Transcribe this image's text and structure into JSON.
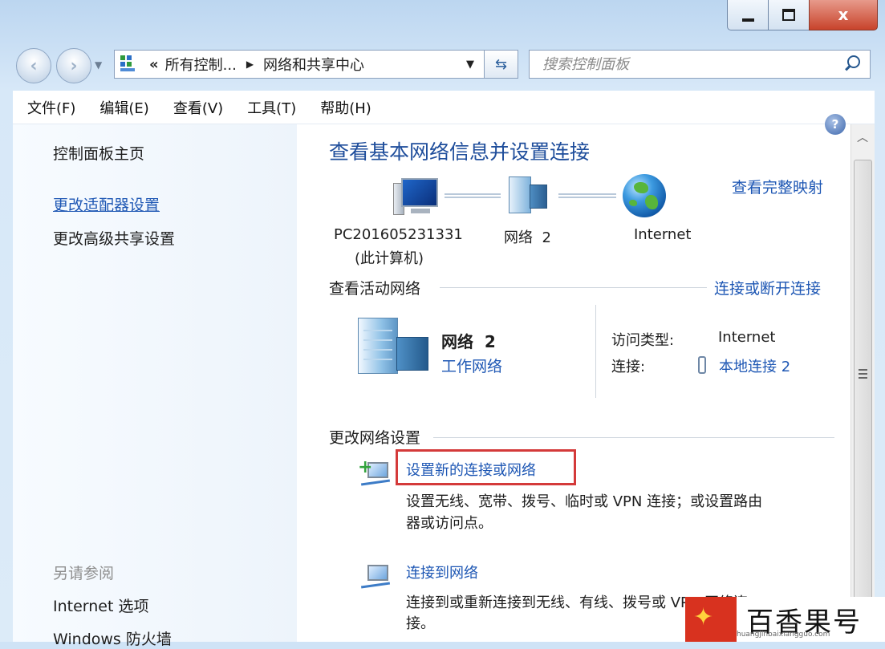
{
  "window": {
    "minimize_glyph": "",
    "maximize_glyph": "",
    "close_glyph": "x"
  },
  "address_bar": {
    "crumb_1": "所有控制...",
    "crumb_2": "网络和共享中心"
  },
  "search": {
    "placeholder": "搜索控制面板"
  },
  "menu": {
    "items": [
      {
        "label": "文件(F)"
      },
      {
        "label": "编辑(E)"
      },
      {
        "label": "查看(V)"
      },
      {
        "label": "工具(T)"
      },
      {
        "label": "帮助(H)"
      }
    ]
  },
  "sidebar": {
    "home": "控制面板主页",
    "adapter_link": "更改适配器设置",
    "advanced_sharing": "更改高级共享设置",
    "see_also_header": "另请参阅",
    "see_also": [
      {
        "label": "Internet 选项"
      },
      {
        "label": "Windows 防火墙"
      }
    ]
  },
  "main": {
    "title": "查看基本网络信息并设置连接",
    "full_map_link": "查看完整映射",
    "map": {
      "computer_name": "PC201605231331",
      "computer_sub": "(此计算机)",
      "network": "网络  2",
      "internet": "Internet"
    },
    "active_networks": {
      "header": "查看活动网络",
      "connect_link": "连接或断开连接",
      "network_name": "网络  2",
      "network_type": "工作网络",
      "access_type_label": "访问类型:",
      "access_type_value": "Internet",
      "connection_label": "连接:",
      "connection_value": "本地连接 2"
    },
    "change_settings": {
      "header": "更改网络设置",
      "items": [
        {
          "title": "设置新的连接或网络",
          "desc_1": "设置无线、宽带、拨号、临时或 VPN 连接；或设置路由",
          "desc_2": "器或访问点。"
        },
        {
          "title": "连接到网络",
          "desc_1": "连接到或重新连接到无线、有线、拨号或 VPN 网络连",
          "desc_2": "接。"
        }
      ]
    }
  },
  "watermark": {
    "title": "百香果号",
    "url": "huangjinbaixiangguo.com"
  },
  "colors": {
    "link": "#1e57b4",
    "title": "#1e4d9b",
    "highlight": "#d43a3a",
    "close_button": "#c8432b"
  }
}
